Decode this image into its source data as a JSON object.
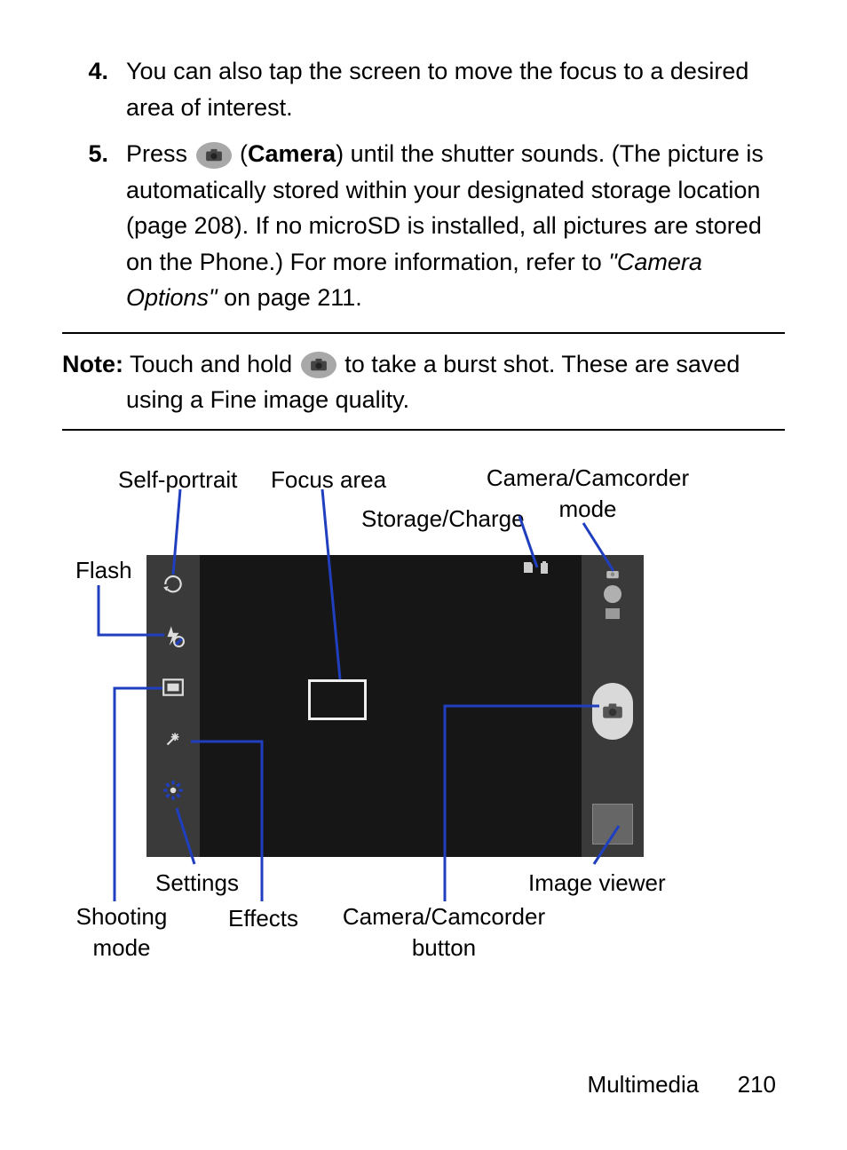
{
  "list": {
    "item4": {
      "num": "4.",
      "text": "You can also tap the screen to move the focus to a desired area of interest."
    },
    "item5": {
      "num": "5.",
      "p1a": "Press ",
      "p1b": " (",
      "camera_word": "Camera",
      "p1c": ") until the shutter sounds. (The picture is automatically stored within your designated storage location (page 208). If no microSD is installed, all pictures are stored on the Phone.) For more information, refer to ",
      "ref": "\"Camera Options\"",
      "p1d": " on page 211."
    }
  },
  "note": {
    "label": "Note:",
    "t1": " Touch and hold ",
    "t2": " to take a burst shot. These are saved using a Fine image quality."
  },
  "labels": {
    "self_portrait": "Self-portrait",
    "focus_area": "Focus area",
    "cam_mode": "Camera/Camcorder mode",
    "storage": "Storage/Charge",
    "flash": "Flash",
    "settings": "Settings",
    "shooting_mode": "Shooting mode",
    "effects": "Effects",
    "cam_button": "Camera/Camcorder button",
    "image_viewer": "Image viewer"
  },
  "footer": {
    "section": "Multimedia",
    "page": "210"
  }
}
